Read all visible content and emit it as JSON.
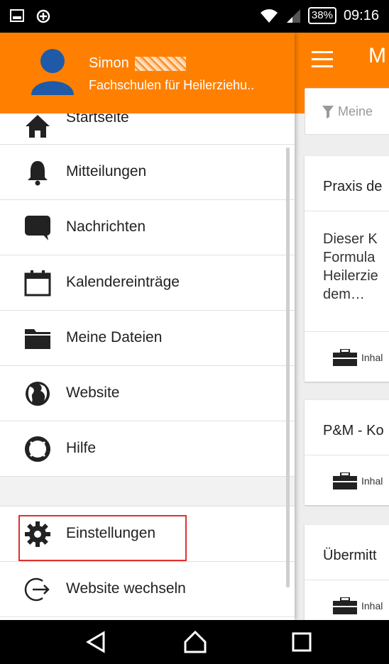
{
  "status_bar": {
    "battery_percent": "38%",
    "time": "09:16",
    "icons": [
      "screenshot-icon",
      "data-saver-icon",
      "wifi-icon",
      "signal-icon",
      "battery-icon"
    ]
  },
  "drawer": {
    "user": {
      "name": "Simon",
      "school": "Fachschulen für Heilerziehu.."
    },
    "items": [
      {
        "label": "Startseite",
        "icon": "home-icon"
      },
      {
        "label": "Mitteilungen",
        "icon": "bell-icon"
      },
      {
        "label": "Nachrichten",
        "icon": "chat-icon"
      },
      {
        "label": "Kalendereinträge",
        "icon": "calendar-icon"
      },
      {
        "label": "Meine Dateien",
        "icon": "folder-icon"
      },
      {
        "label": "Website",
        "icon": "globe-icon"
      },
      {
        "label": "Hilfe",
        "icon": "lifebuoy-icon"
      },
      {
        "label": "Einstellungen",
        "icon": "gear-icon"
      },
      {
        "label": "Website wechseln",
        "icon": "switch-site-icon"
      }
    ]
  },
  "main": {
    "title_fragment": "M",
    "filter_placeholder": "Meine",
    "cards": [
      {
        "title": "Praxis de",
        "text": "Dieser K\nFormula\nHeilerzie\ndem…",
        "footer": "Inhal"
      },
      {
        "title": "P&M - Ko",
        "footer": "Inhal"
      },
      {
        "title": "Übermitt",
        "footer": "Inhal"
      }
    ]
  },
  "colors": {
    "accent": "#ff8000",
    "highlight": "#e0302f"
  }
}
